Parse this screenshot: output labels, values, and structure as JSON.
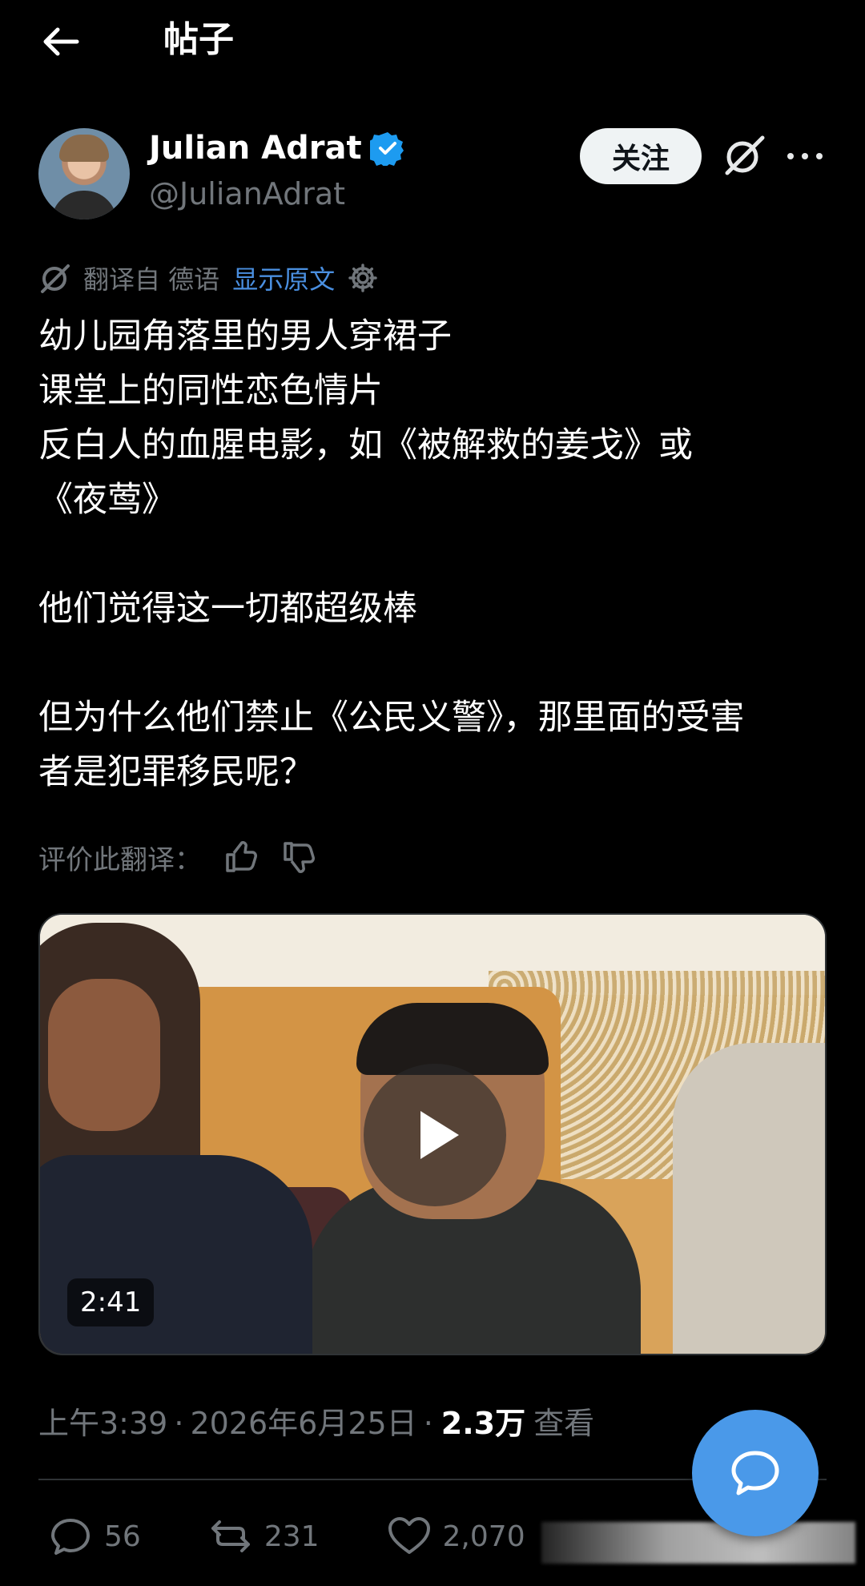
{
  "topbar": {
    "title": "帖子"
  },
  "author": {
    "display_name": "Julian Adrat",
    "handle": "@JulianAdrat",
    "verified": true,
    "follow_label": "关注"
  },
  "translation": {
    "translated_from": "翻译自 德语",
    "show_original": "显示原文"
  },
  "tweet": {
    "lines": [
      "幼儿园角落里的男人穿裙子",
      "课堂上的同性恋色情片",
      "反白人的血腥电影，如《被解救的姜戈》或",
      "《夜莺》",
      "",
      "他们觉得这一切都超级棒",
      "",
      "但为什么他们禁止《公民义警》，那里面的受害",
      "者是犯罪移民呢？"
    ]
  },
  "rate": {
    "label": "评价此翻译："
  },
  "video": {
    "duration": "2:41"
  },
  "meta": {
    "time": "上午3:39",
    "date": "2026年6月25日",
    "sep": "·",
    "views_count": "2.3万",
    "views_label": "查看"
  },
  "actions": {
    "replies": "56",
    "reposts": "231",
    "likes": "2,070"
  },
  "colors": {
    "background": "#000000",
    "link": "#4a8fe0",
    "verified": "#1d9bf0",
    "fab": "#4a99e9",
    "muted": "#71767b"
  },
  "icons": [
    "back-arrow-icon",
    "verified-badge-icon",
    "grok-icon",
    "more-icon",
    "translate-icon",
    "settings-icon",
    "thumbs-up-icon",
    "thumbs-down-icon",
    "play-icon",
    "reply-icon",
    "repost-icon",
    "like-icon",
    "compose-message-icon"
  ]
}
